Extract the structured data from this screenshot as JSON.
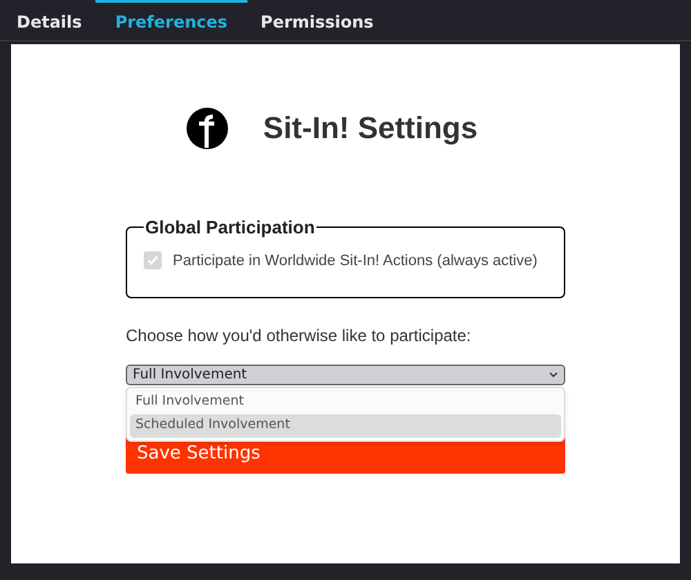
{
  "tabs": [
    {
      "label": "Details",
      "selected": false
    },
    {
      "label": "Preferences",
      "selected": true
    },
    {
      "label": "Permissions",
      "selected": false
    }
  ],
  "title": "Sit-In! Settings",
  "global_participation": {
    "legend": "Global Participation",
    "checkbox": {
      "label": "Participate in Worldwide Sit-In! Actions (always active)",
      "checked": true,
      "disabled": true
    }
  },
  "participation_label": "Choose how you'd otherwise like to participate:",
  "select": {
    "value": "Full Involvement",
    "expanded": true,
    "options": [
      {
        "label": "Full Involvement",
        "highlighted": false
      },
      {
        "label": "Scheduled Involvement",
        "highlighted": true
      }
    ]
  },
  "save_button": "Save Settings"
}
